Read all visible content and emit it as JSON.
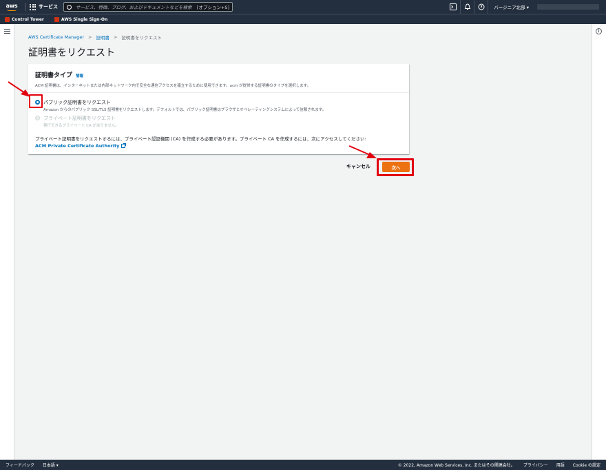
{
  "topnav": {
    "logo": "aws",
    "services_label": "サービス",
    "search_placeholder": "サービス、特徴、ブログ、およびドキュメントなどを検索",
    "search_shortcut": "[オプション+S]",
    "region_label": "バージニア北部 ▾"
  },
  "favorites": [
    {
      "label": "Control Tower"
    },
    {
      "label": "AWS Single Sign-On"
    }
  ],
  "breadcrumb": {
    "root": "AWS Certificate Manager",
    "section": "証明書",
    "current": "証明書をリクエスト"
  },
  "page_title": "証明書をリクエスト",
  "panel": {
    "title": "証明書タイプ",
    "info_link": "情報",
    "description": "ACM 証明書は、インターネットまたは内部ネットワーク内で安全な通信アクセスを確立するために使用できます。acm が提供する証明書のタイプを選択します。",
    "options": [
      {
        "label": "パブリック証明書をリクエスト",
        "sub": "Amazon からのパブリック SSL/TLS 証明書をリクエストします。デフォルトでは、パブリック証明書はブラウザとオペレーティングシステムによって信頼されます。"
      },
      {
        "label": "プライベート証明書をリクエスト",
        "sub": "発行できるプライベート CA がありません。"
      }
    ],
    "note": "プライベート証明書をリクエストするには、プライベート認証機関 (CA) を作成する必要があります。プライベート CA を作成するには、次にアクセスしてください:",
    "note_link": "ACM Private Certificate Authority"
  },
  "actions": {
    "cancel": "キャンセル",
    "next": "次へ"
  },
  "footer": {
    "feedback": "フィードバック",
    "language": "日本語 ▾",
    "copyright": "© 2022, Amazon Web Services, Inc. またはその関連会社。",
    "privacy": "プライバシー",
    "terms": "用語",
    "cookie": "Cookie の設定"
  },
  "colors": {
    "nav_bg": "#232f3e",
    "link": "#0073bb",
    "primary_button": "#ec7211",
    "highlight": "#e2000f"
  }
}
